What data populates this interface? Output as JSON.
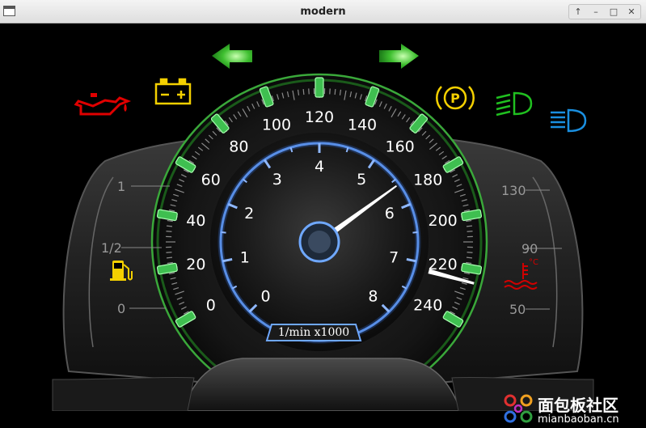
{
  "window": {
    "title": "modern",
    "controls": [
      "↑",
      "–",
      "□",
      "✕"
    ]
  },
  "speedometer": {
    "ticks": [
      "0",
      "20",
      "40",
      "60",
      "80",
      "100",
      "120",
      "140",
      "160",
      "180",
      "200",
      "220",
      "240"
    ],
    "needle_value": 225
  },
  "tachometer": {
    "ticks": [
      "0",
      "1",
      "2",
      "3",
      "4",
      "5",
      "6",
      "7",
      "8"
    ],
    "unit_label": "1/min x1000",
    "needle_value": 5.6
  },
  "fuel_gauge": {
    "labels": [
      "1",
      "1/2",
      "0"
    ]
  },
  "temp_gauge": {
    "labels": [
      "130",
      "90",
      "50"
    ]
  },
  "indicators": {
    "left_turn": {
      "state": "on",
      "color": "#33cc33"
    },
    "right_turn": {
      "state": "on",
      "color": "#33cc33"
    },
    "oil": {
      "state": "on",
      "color": "#e00000"
    },
    "battery": {
      "state": "on",
      "color": "#f4d000"
    },
    "parking_brake": {
      "state": "on",
      "color": "#f4d000",
      "symbol": "P"
    },
    "low_beam": {
      "state": "on",
      "color": "#20c020"
    },
    "high_beam": {
      "state": "on",
      "color": "#1a8fe0"
    },
    "fuel": {
      "color": "#f4d000"
    },
    "coolant": {
      "color": "#d00000",
      "symbol": "°C"
    }
  },
  "watermark": {
    "text": "面包板社区",
    "url": "mianbaoban.cn"
  }
}
